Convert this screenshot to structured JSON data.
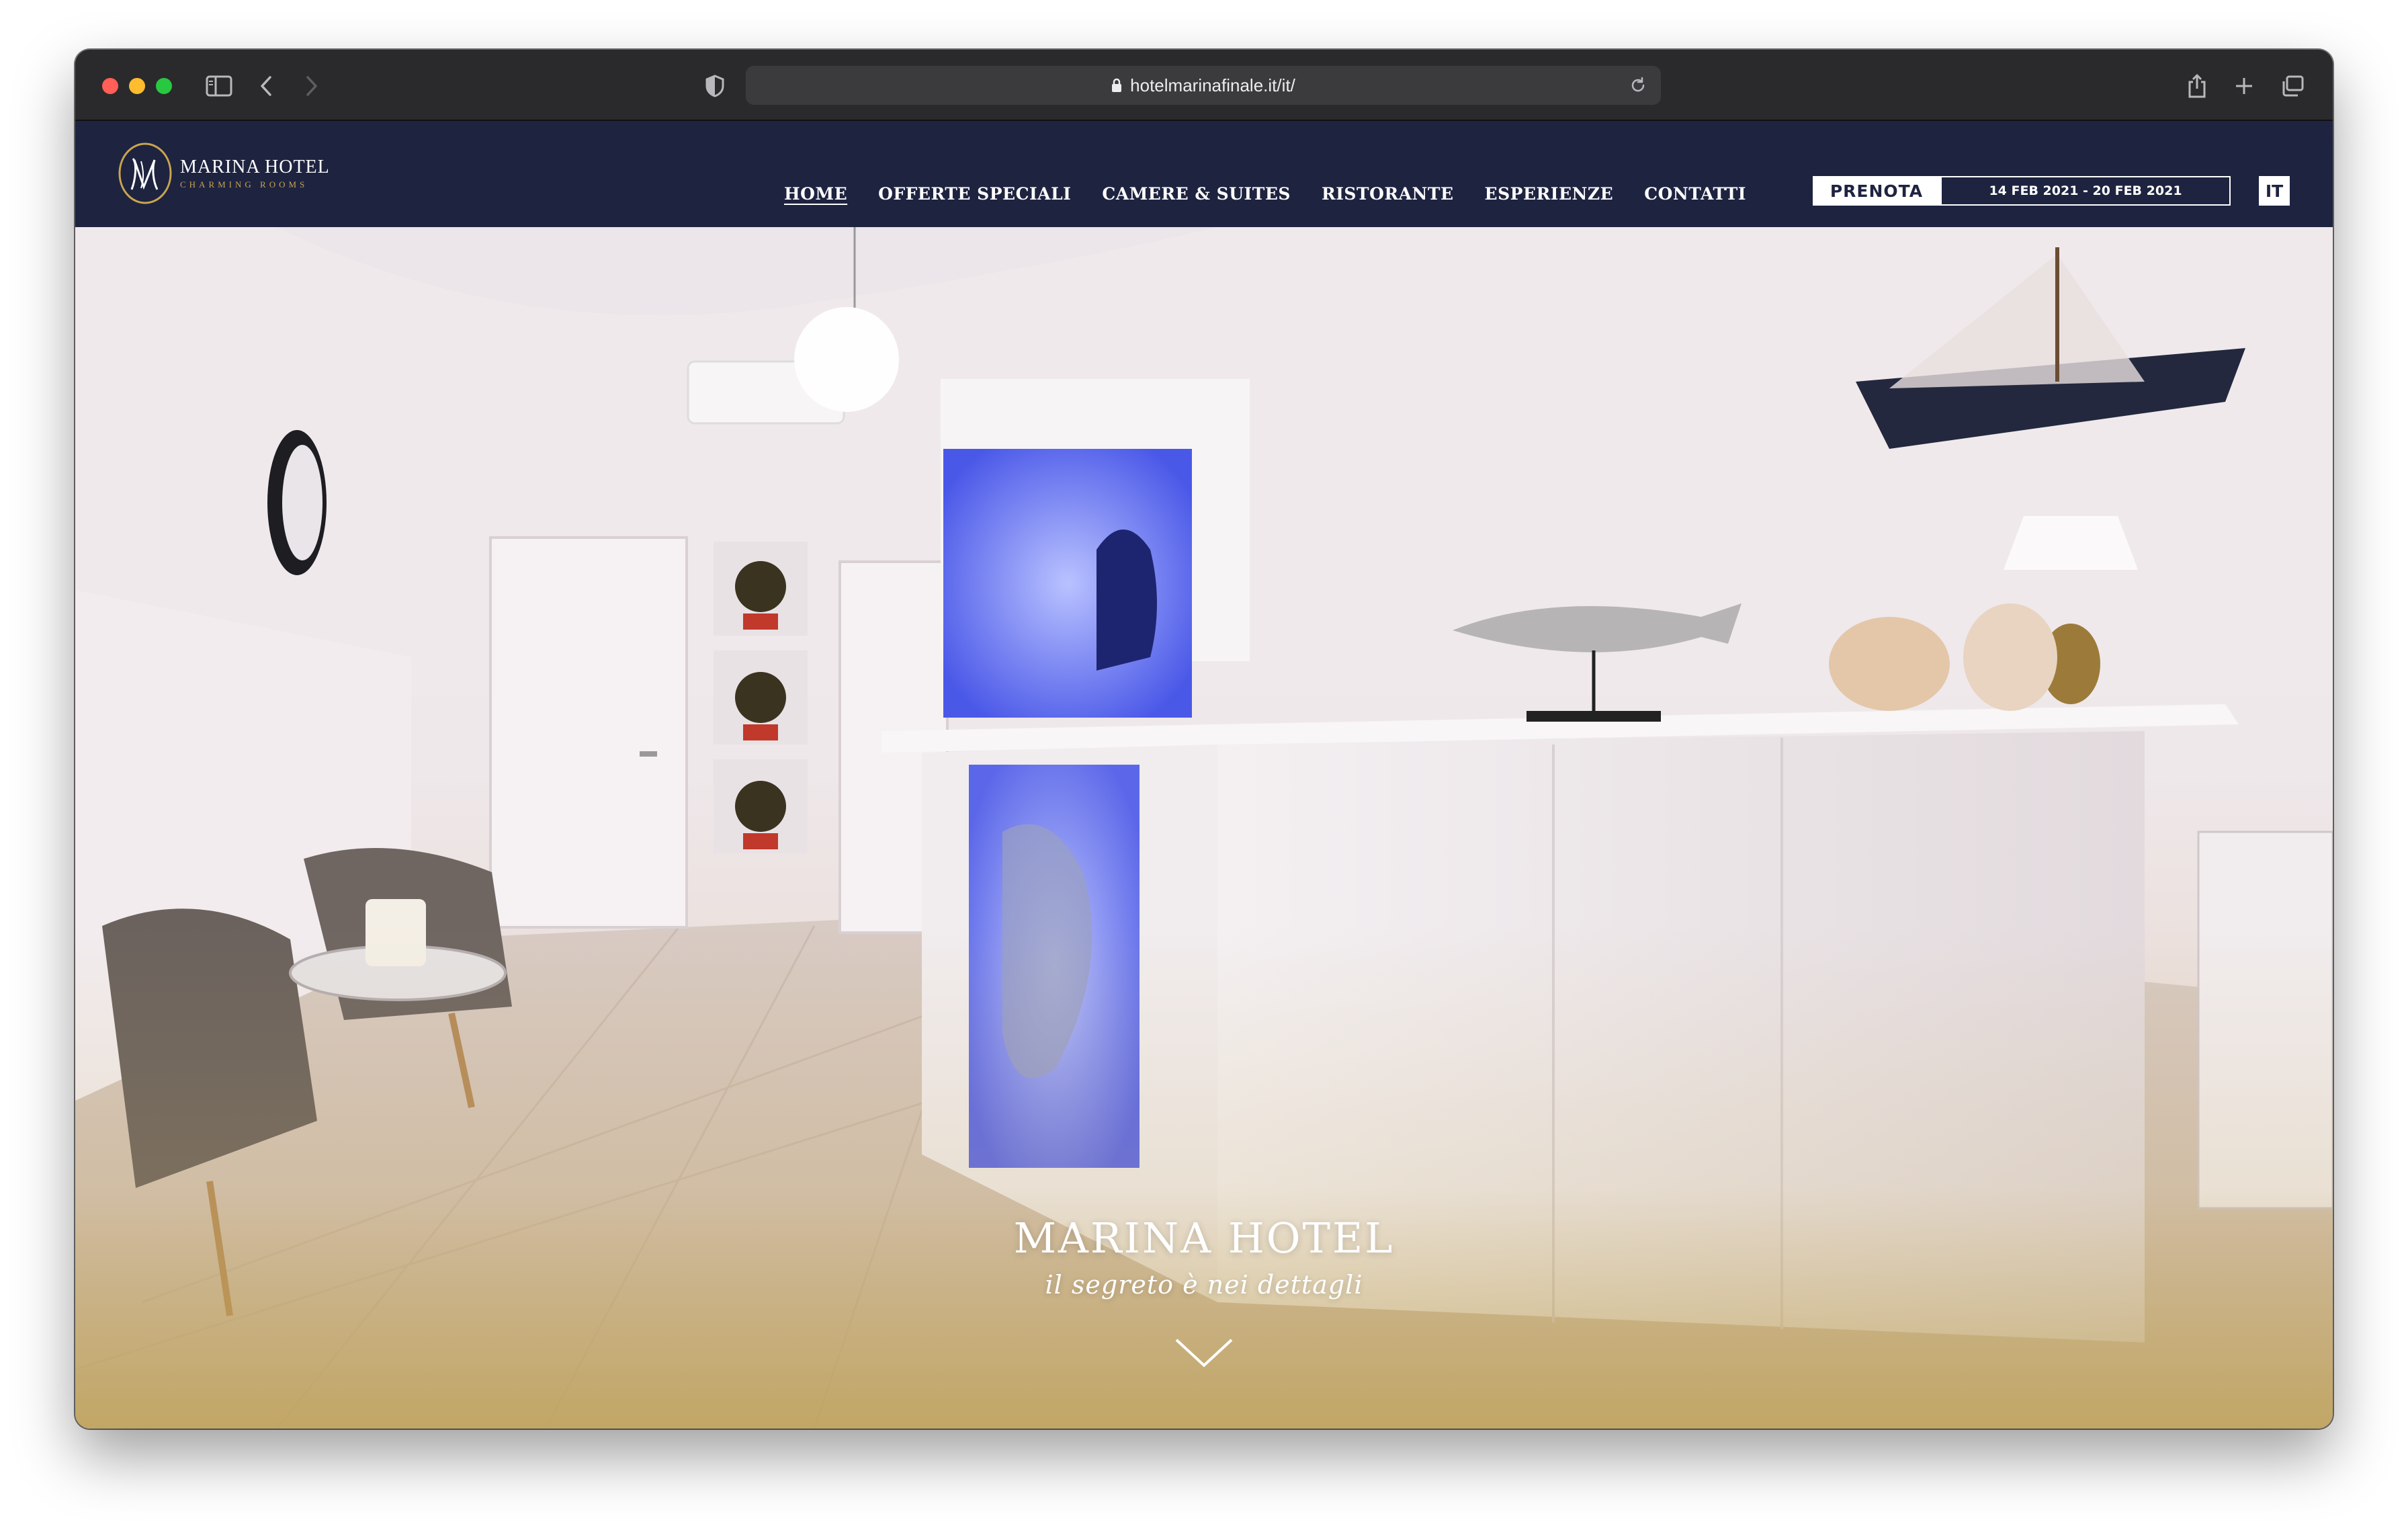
{
  "browser": {
    "url": "hotelmarinafinale.it/it/",
    "icons": [
      "sidebar-icon",
      "back-icon",
      "forward-icon",
      "shield-icon",
      "lock-icon",
      "reload-icon",
      "share-icon",
      "plus-icon",
      "tabs-icon"
    ]
  },
  "site": {
    "logo": {
      "name": "MARINA HOTEL",
      "subtitle": "CHARMING ROOMS"
    },
    "nav": [
      {
        "label": "HOME",
        "active": true
      },
      {
        "label": "OFFERTE SPECIALI"
      },
      {
        "label": "CAMERE & SUITES"
      },
      {
        "label": "RISTORANTE"
      },
      {
        "label": "ESPERIENZE"
      },
      {
        "label": "CONTATTI"
      }
    ],
    "booking": {
      "button_label": "PRENOTA",
      "dates": "14 FEB 2021 - 20 FEB 2021"
    },
    "language": "IT",
    "hero": {
      "title": "MARINA HOTEL",
      "tagline": "il segreto è nei dettagli"
    },
    "colors": {
      "header_bg": "#1e2340",
      "accent_gold": "#c8a54f"
    }
  }
}
